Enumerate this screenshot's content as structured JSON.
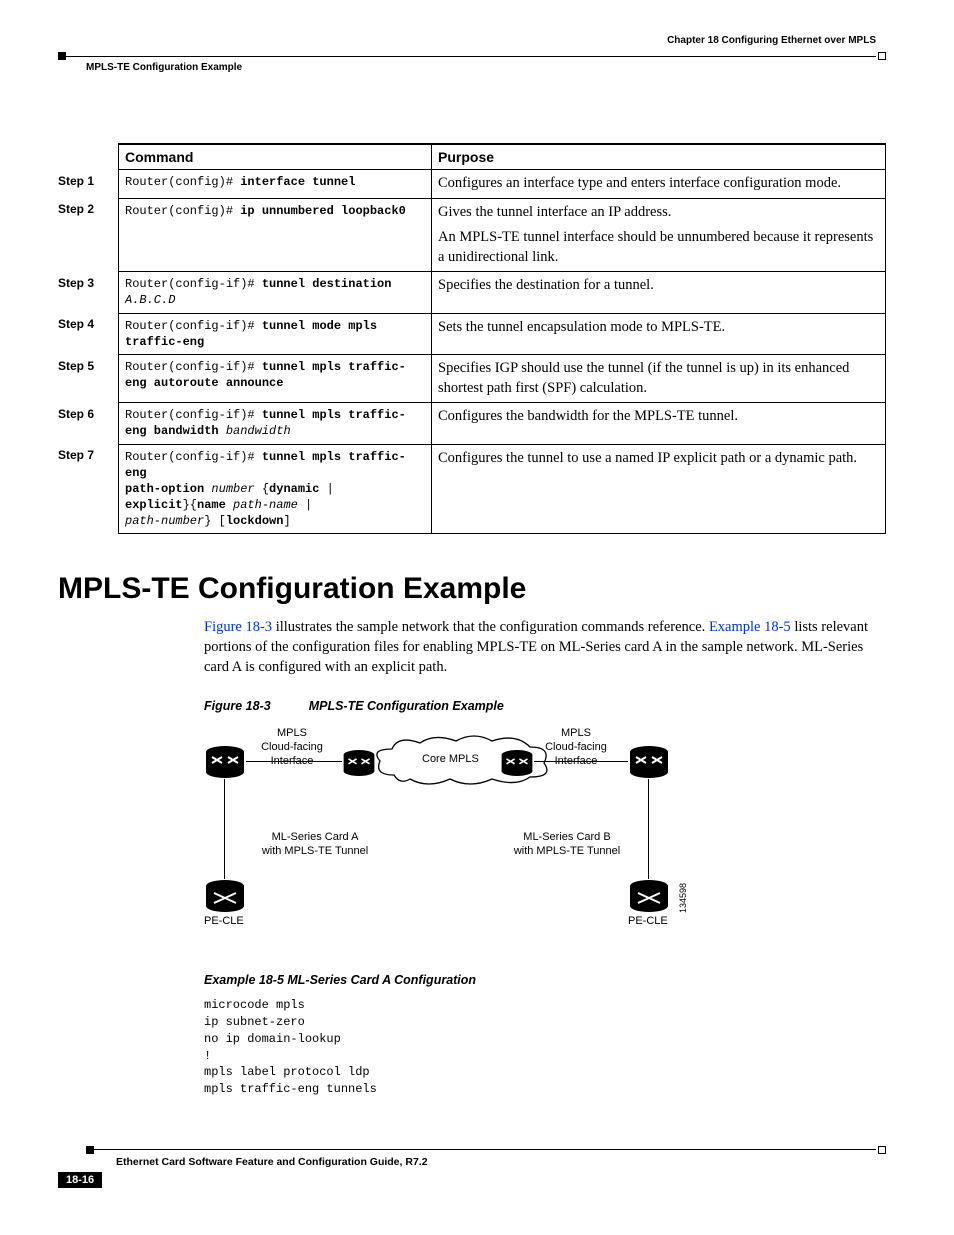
{
  "header": {
    "chapter": "Chapter 18    Configuring Ethernet over MPLS",
    "section": "MPLS-TE Configuration Example"
  },
  "table": {
    "col_command": "Command",
    "col_purpose": "Purpose",
    "steps": {
      "s1": {
        "label": "Step 1",
        "prefix": "Router(config)# ",
        "bold": "interface tunnel",
        "purpose": "Configures an interface type and enters interface configuration mode."
      },
      "s2": {
        "label": "Step 2",
        "prefix": "Router(config)# ",
        "bold": "ip unnumbered loopback0",
        "purpose1": "Gives the tunnel interface an IP address.",
        "purpose2": "An MPLS-TE tunnel interface should be unnumbered because it represents a unidirectional link."
      },
      "s3": {
        "label": "Step 3",
        "prefix": "Router(config-if)# ",
        "bold": "tunnel destination",
        "italic": "A.B.C.D",
        "purpose": "Specifies the destination for a tunnel."
      },
      "s4": {
        "label": "Step 4",
        "prefix": "Router(config-if)# ",
        "bold": "tunnel mode mpls traffic-eng",
        "purpose": "Sets the tunnel encapsulation mode to MPLS-TE."
      },
      "s5": {
        "label": "Step 5",
        "prefix": "Router(config-if)# ",
        "bold": "tunnel mpls traffic-eng autoroute announce",
        "purpose": "Specifies IGP should use the tunnel (if the tunnel is up) in its enhanced shortest path first (SPF) calculation."
      },
      "s6": {
        "label": "Step 6",
        "prefix": "Router(config-if)# ",
        "bold": "tunnel mpls traffic-eng bandwidth",
        "italic": "bandwidth",
        "purpose": "Configures the bandwidth for the MPLS-TE tunnel."
      },
      "s7": {
        "label": "Step 7",
        "prefix": "Router(config-if)# ",
        "b1": "tunnel mpls traffic-eng",
        "b2": "path-option",
        "i1": "number",
        "b3": "dynamic",
        "b4": "explicit",
        "b5": "name",
        "i2": "path-name",
        "i3": "path-number",
        "b6": "lockdown",
        "purpose": "Configures the tunnel to use a named IP explicit path or a dynamic path."
      }
    }
  },
  "heading_main": "MPLS-TE Configuration Example",
  "intro": {
    "link1": "Figure 18-3",
    "mid": "illustrates the sample network that the configuration commands reference.",
    "link2": "Example 18-5",
    "tail": "lists relevant portions of the configuration files for enabling MPLS-TE on ML-Series card A in the sample network. ML-Series card A is configured with an explicit path."
  },
  "figure": {
    "cap_num": "Figure 18-3",
    "cap_title": "MPLS-TE Configuration Example",
    "labels": {
      "cloud_left": "MPLS\nCloud-facing\nInterface",
      "cloud_right": "MPLS\nCloud-facing\nInterface",
      "core": "Core MPLS",
      "cardA": "ML-Series Card A\nwith MPLS-TE Tunnel",
      "cardB": "ML-Series Card B\nwith MPLS-TE Tunnel",
      "pe_left": "PE-CLE",
      "pe_right": "PE-CLE",
      "sideid": "134598"
    }
  },
  "example": {
    "caption": "Example 18-5   ML-Series Card A Configuration",
    "code": "microcode mpls\nip subnet-zero\nno ip domain-lookup\n!\nmpls label protocol ldp\nmpls traffic-eng tunnels"
  },
  "footer": {
    "guide": "Ethernet Card Software Feature and Configuration Guide, R7.2",
    "pagenum": "18-16"
  }
}
